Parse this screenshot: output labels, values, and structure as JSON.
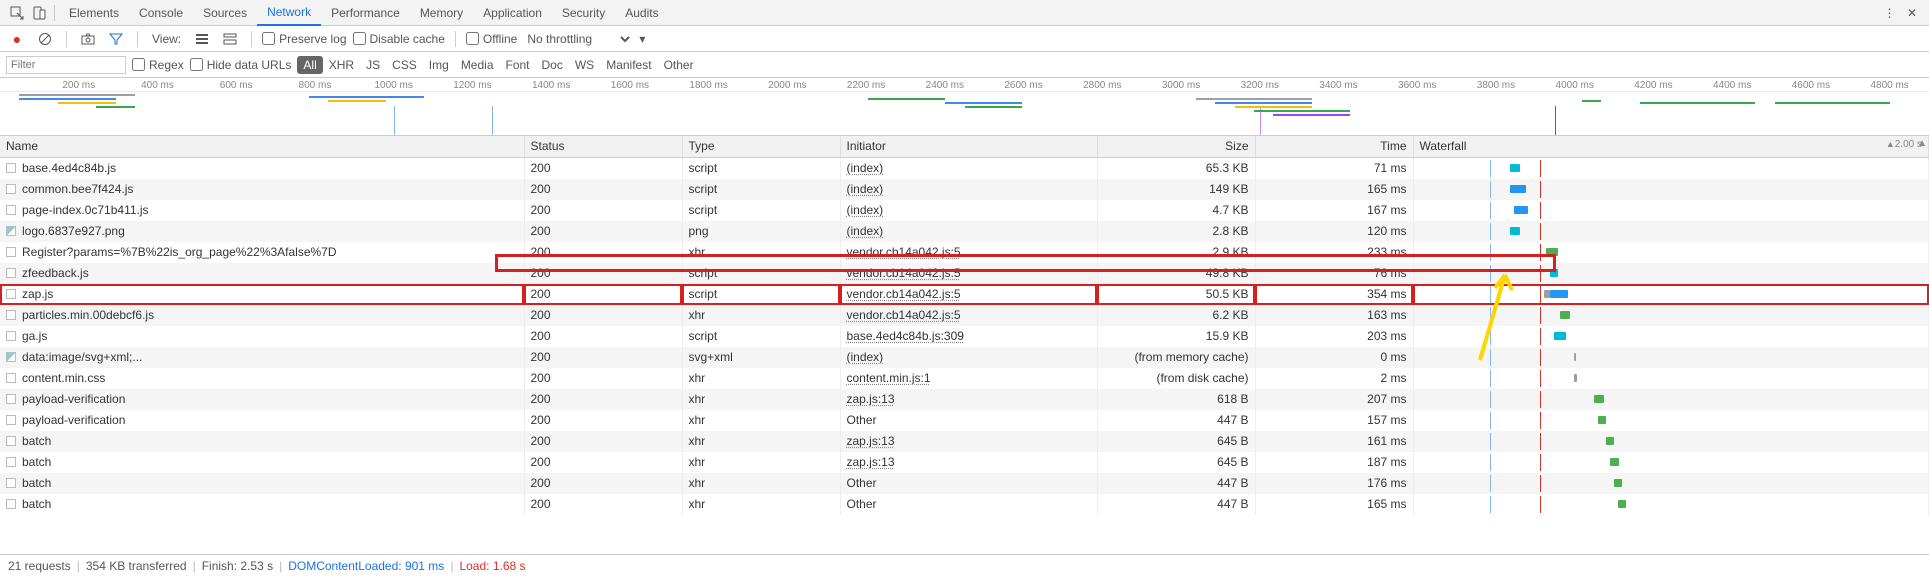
{
  "tabs": {
    "items": [
      "Elements",
      "Console",
      "Sources",
      "Network",
      "Performance",
      "Memory",
      "Application",
      "Security",
      "Audits"
    ],
    "active": "Network"
  },
  "toolbar": {
    "view_label": "View:",
    "preserve_log": "Preserve log",
    "disable_cache": "Disable cache",
    "offline": "Offline",
    "throttling": "No throttling"
  },
  "filter": {
    "placeholder": "Filter",
    "regex": "Regex",
    "hide_data_urls": "Hide data URLs",
    "types": [
      "All",
      "XHR",
      "JS",
      "CSS",
      "Img",
      "Media",
      "Font",
      "Doc",
      "WS",
      "Manifest",
      "Other"
    ],
    "active_type": "All"
  },
  "overview": {
    "ticks": [
      "200 ms",
      "400 ms",
      "600 ms",
      "800 ms",
      "1000 ms",
      "1200 ms",
      "1400 ms",
      "1600 ms",
      "1800 ms",
      "2000 ms",
      "2200 ms",
      "2400 ms",
      "2600 ms",
      "2800 ms",
      "3000 ms",
      "3200 ms",
      "3400 ms",
      "3600 ms",
      "3800 ms",
      "4000 ms",
      "4200 ms",
      "4400 ms",
      "4600 ms",
      "4800 ms"
    ],
    "max_ms": 4900
  },
  "columns": {
    "name": "Name",
    "status": "Status",
    "type": "Type",
    "initiator": "Initiator",
    "size": "Size",
    "time": "Time",
    "waterfall": "Waterfall",
    "waterfall_scale": "2.00 s"
  },
  "rows": [
    {
      "name": "base.4ed4c84b.js",
      "status": "200",
      "type": "script",
      "initiator": "(index)",
      "initiator_link": true,
      "size": "65.3 KB",
      "time": "71 ms",
      "wf": {
        "start": 1480,
        "dur": 10,
        "color": "wf-teal"
      }
    },
    {
      "name": "common.bee7f424.js",
      "status": "200",
      "type": "script",
      "initiator": "(index)",
      "initiator_link": true,
      "size": "149 KB",
      "time": "165 ms",
      "wf": {
        "start": 1480,
        "dur": 16,
        "color": "wf-dl"
      }
    },
    {
      "name": "page-index.0c71b411.js",
      "status": "200",
      "type": "script",
      "initiator": "(index)",
      "initiator_link": true,
      "size": "4.7 KB",
      "time": "167 ms",
      "wf": {
        "start": 1482,
        "dur": 14,
        "color": "wf-dl"
      }
    },
    {
      "name": "logo.6837e927.png",
      "ico": "img",
      "status": "200",
      "type": "png",
      "initiator": "(index)",
      "initiator_link": true,
      "size": "2.8 KB",
      "time": "120 ms",
      "wf": {
        "start": 1480,
        "dur": 10,
        "color": "wf-teal"
      }
    },
    {
      "name": "Register?params=%7B%22is_org_page%22%3Afalse%7D",
      "status": "200",
      "type": "xhr",
      "initiator": "vendor.cb14a042.js:5",
      "initiator_link": true,
      "size": "2.9 KB",
      "time": "233 ms",
      "wf": {
        "start": 1498,
        "dur": 12,
        "color": "wf-green"
      }
    },
    {
      "name": "zfeedback.js",
      "status": "200",
      "type": "script",
      "initiator": "vendor.cb14a042.js:5",
      "initiator_link": true,
      "size": "49.8 KB",
      "time": "76 ms",
      "wf": {
        "start": 1500,
        "dur": 8,
        "color": "wf-teal"
      }
    },
    {
      "name": "zap.js",
      "highlight": true,
      "status": "200",
      "type": "script",
      "initiator": "vendor.cb14a042.js:5",
      "initiator_link": true,
      "size": "50.5 KB",
      "time": "354 ms",
      "wf": {
        "start": 1500,
        "dur": 18,
        "color": "wf-dl",
        "pre": 6
      }
    },
    {
      "name": "particles.min.00debcf6.js",
      "status": "200",
      "type": "xhr",
      "initiator": "vendor.cb14a042.js:5",
      "initiator_link": true,
      "size": "6.2 KB",
      "time": "163 ms",
      "wf": {
        "start": 1505,
        "dur": 10,
        "color": "wf-green"
      }
    },
    {
      "name": "ga.js",
      "status": "200",
      "type": "script",
      "initiator": "base.4ed4c84b.js:309",
      "initiator_link": true,
      "size": "15.9 KB",
      "time": "203 ms",
      "wf": {
        "start": 1502,
        "dur": 12,
        "color": "wf-teal"
      }
    },
    {
      "name": "data:image/svg+xml;...",
      "ico": "img",
      "status": "200",
      "type": "svg+xml",
      "initiator": "(index)",
      "initiator_link": true,
      "size": "(from memory cache)",
      "size_muted": true,
      "time": "0 ms",
      "wf": {
        "start": 1512,
        "dur": 2,
        "color": "wf-wait"
      }
    },
    {
      "name": "content.min.css",
      "status": "200",
      "type": "xhr",
      "initiator": "content.min.js:1",
      "initiator_link": true,
      "size": "(from disk cache)",
      "size_muted": true,
      "time": "2 ms",
      "wf": {
        "start": 1512,
        "dur": 3,
        "color": "wf-wait"
      }
    },
    {
      "name": "payload-verification",
      "status": "200",
      "type": "xhr",
      "initiator": "zap.js:13",
      "initiator_link": true,
      "size": "618 B",
      "time": "207 ms",
      "wf": {
        "start": 1522,
        "dur": 10,
        "color": "wf-green"
      }
    },
    {
      "name": "payload-verification",
      "status": "200",
      "type": "xhr",
      "initiator": "Other",
      "initiator_link": false,
      "size": "447 B",
      "time": "157 ms",
      "wf": {
        "start": 1524,
        "dur": 8,
        "color": "wf-green"
      }
    },
    {
      "name": "batch",
      "status": "200",
      "type": "xhr",
      "initiator": "zap.js:13",
      "initiator_link": true,
      "size": "645 B",
      "time": "161 ms",
      "wf": {
        "start": 1528,
        "dur": 8,
        "color": "wf-green"
      }
    },
    {
      "name": "batch",
      "status": "200",
      "type": "xhr",
      "initiator": "zap.js:13",
      "initiator_link": true,
      "size": "645 B",
      "time": "187 ms",
      "wf": {
        "start": 1530,
        "dur": 9,
        "color": "wf-green"
      }
    },
    {
      "name": "batch",
      "status": "200",
      "type": "xhr",
      "initiator": "Other",
      "initiator_link": false,
      "size": "447 B",
      "time": "176 ms",
      "wf": {
        "start": 1532,
        "dur": 8,
        "color": "wf-green"
      }
    },
    {
      "name": "batch",
      "status": "200",
      "type": "xhr",
      "initiator": "Other",
      "initiator_link": false,
      "size": "447 B",
      "time": "165 ms",
      "wf": {
        "start": 1534,
        "dur": 8,
        "color": "wf-green"
      }
    }
  ],
  "status": {
    "requests": "21 requests",
    "transferred": "354 KB transferred",
    "finish": "Finish: 2.53 s",
    "dcl_label": "DOMContentLoaded:",
    "dcl_value": "901 ms",
    "load_label": "Load:",
    "load_value": "1.68 s"
  }
}
